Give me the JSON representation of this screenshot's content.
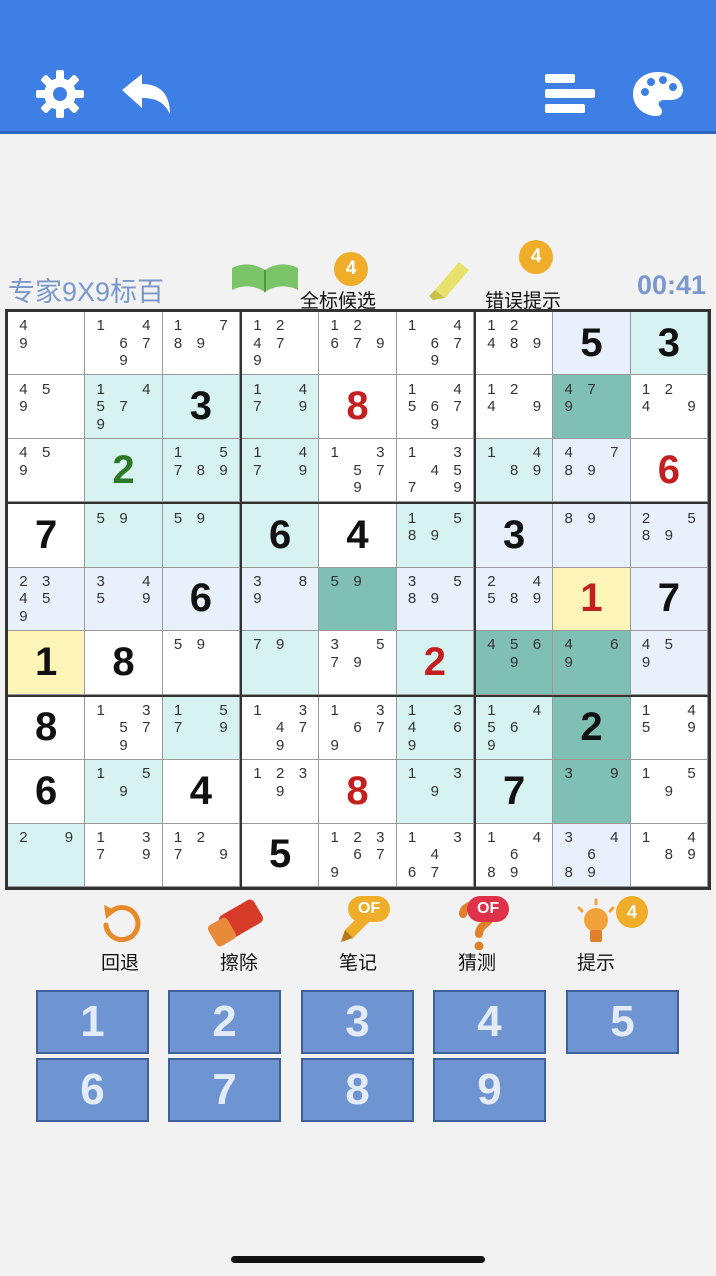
{
  "header": {
    "settings_icon": "gear-icon",
    "undo_icon": "back-arrow-icon",
    "stats_icon": "bars-icon",
    "theme_icon": "palette-icon"
  },
  "info": {
    "level": "专家9X9标百",
    "timer": "00:41",
    "all_candidates": {
      "label": "全标候选",
      "badge": "4"
    },
    "error_hint": {
      "label": "错误提示",
      "badge": "4"
    }
  },
  "board": {
    "cells": [
      [
        {
          "c": "4  9"
        },
        {
          "c": "1 4 67 9"
        },
        {
          "c": "1 789"
        },
        {
          "c": "12 47 9"
        },
        {
          "c": "12 679"
        },
        {
          "c": "1 4 67 9"
        },
        {
          "c": "12 489"
        },
        {
          "v": "5",
          "bg": "#e8f0fb"
        },
        {
          "v": "3",
          "bg": "#d7f3f1"
        }
      ],
      [
        {
          "c": "45 9"
        },
        {
          "c": "1 457 9",
          "bg": "#d7f3f1"
        },
        {
          "v": "3",
          "bg": "#d7f3f1"
        },
        {
          "c": "1 47 9",
          "bg": "#d7f3f1"
        },
        {
          "v": "8",
          "t": "red"
        },
        {
          "c": "1 4567 9"
        },
        {
          "c": "12 4 9"
        },
        {
          "c": "47 9",
          "bg": "#7fbfb4"
        },
        {
          "c": "12 4 9"
        }
      ],
      [
        {
          "c": "45 9"
        },
        {
          "v": "2",
          "t": "green",
          "bg": "#d7f3f1"
        },
        {
          "c": "1 5789",
          "bg": "#d7f3f1"
        },
        {
          "c": "1 47 9",
          "bg": "#d7f3f1"
        },
        {
          "c": "1 3 57 9"
        },
        {
          "c": "1 3 457 9"
        },
        {
          "c": "1 4 89",
          "bg": "#d7f3f1"
        },
        {
          "c": "4 789",
          "bg": "#e8f0fb"
        },
        {
          "v": "6",
          "t": "red"
        }
      ],
      [
        {
          "v": "7"
        },
        {
          "c": "59",
          "bg": "#d7f3f1"
        },
        {
          "c": "59",
          "bg": "#d7f3f1"
        },
        {
          "v": "6",
          "bg": "#d7f3f1"
        },
        {
          "v": "4"
        },
        {
          "c": "1 589",
          "bg": "#d7f3f1"
        },
        {
          "v": "3",
          "bg": "#e8f0fb"
        },
        {
          "c": "89",
          "bg": "#e8f0fb"
        },
        {
          "c": "2 589",
          "bg": "#e8f0fb"
        }
      ],
      [
        {
          "c": "23 45 9",
          "bg": "#e8f0fb"
        },
        {
          "c": "3 45 9",
          "bg": "#e8f0fb"
        },
        {
          "v": "6",
          "bg": "#e8f0fb"
        },
        {
          "c": "3 89",
          "bg": "#e8f0fb"
        },
        {
          "c": "59",
          "bg": "#7fbfb4"
        },
        {
          "c": "3 589",
          "bg": "#e8f0fb"
        },
        {
          "c": "2 4589",
          "bg": "#e8f0fb"
        },
        {
          "v": "1",
          "t": "red",
          "bg": "#fdf4b8"
        },
        {
          "v": "7",
          "bg": "#e8f0fb"
        }
      ],
      [
        {
          "v": "1",
          "bg": "#fdf4b8"
        },
        {
          "v": "8"
        },
        {
          "c": "59"
        },
        {
          "c": "79",
          "bg": "#d7f3f1"
        },
        {
          "c": "3 579"
        },
        {
          "v": "2",
          "t": "red",
          "bg": "#d7f3f1"
        },
        {
          "c": "456 9",
          "bg": "#7fbfb4"
        },
        {
          "c": "4 69",
          "bg": "#7fbfb4"
        },
        {
          "c": "45 9",
          "bg": "#e8f0fb"
        }
      ],
      [
        {
          "v": "8"
        },
        {
          "c": "1 3 57 9"
        },
        {
          "c": "1 57 9",
          "bg": "#d7f3f1"
        },
        {
          "c": "1 3 47 9"
        },
        {
          "c": "1 3 679"
        },
        {
          "c": "1 34 69",
          "bg": "#d7f3f1"
        },
        {
          "c": "1 456 9",
          "bg": "#d7f3f1"
        },
        {
          "v": "2",
          "bg": "#7fbfb4"
        },
        {
          "c": "1 45 9"
        }
      ],
      [
        {
          "v": "6"
        },
        {
          "c": "1 5 9",
          "bg": "#d7f3f1"
        },
        {
          "v": "4"
        },
        {
          "c": "123 9"
        },
        {
          "v": "8",
          "t": "red"
        },
        {
          "c": "1 3 9",
          "bg": "#d7f3f1"
        },
        {
          "v": "7",
          "bg": "#d7f3f1"
        },
        {
          "c": "3 9",
          "bg": "#7fbfb4"
        },
        {
          "c": "1 5 9"
        }
      ],
      [
        {
          "c": "2 9",
          "bg": "#d7f3f1"
        },
        {
          "c": "1 37 9"
        },
        {
          "c": "12 7 9"
        },
        {
          "v": "5"
        },
        {
          "c": "123 679"
        },
        {
          "c": "1 3 4 67 9"
        },
        {
          "c": "1 4 6 89"
        },
        {
          "c": "3 4 6 89",
          "bg": "#e8f0fb"
        },
        {
          "c": "1 4 89"
        }
      ]
    ]
  },
  "tools": [
    {
      "label": "回退",
      "icon": "undo-icon"
    },
    {
      "label": "擦除",
      "icon": "eraser-icon"
    },
    {
      "label": "笔记",
      "icon": "pencil-icon",
      "pill": "OF",
      "pill_color": "#f0ad2a"
    },
    {
      "label": "猜测",
      "icon": "question-icon",
      "pill": "OF",
      "pill_color": "#e0314a"
    },
    {
      "label": "提示",
      "icon": "lightbulb-icon",
      "badge": "4"
    }
  ],
  "numpad": [
    "1",
    "2",
    "3",
    "4",
    "5",
    "6",
    "7",
    "8",
    "9"
  ]
}
